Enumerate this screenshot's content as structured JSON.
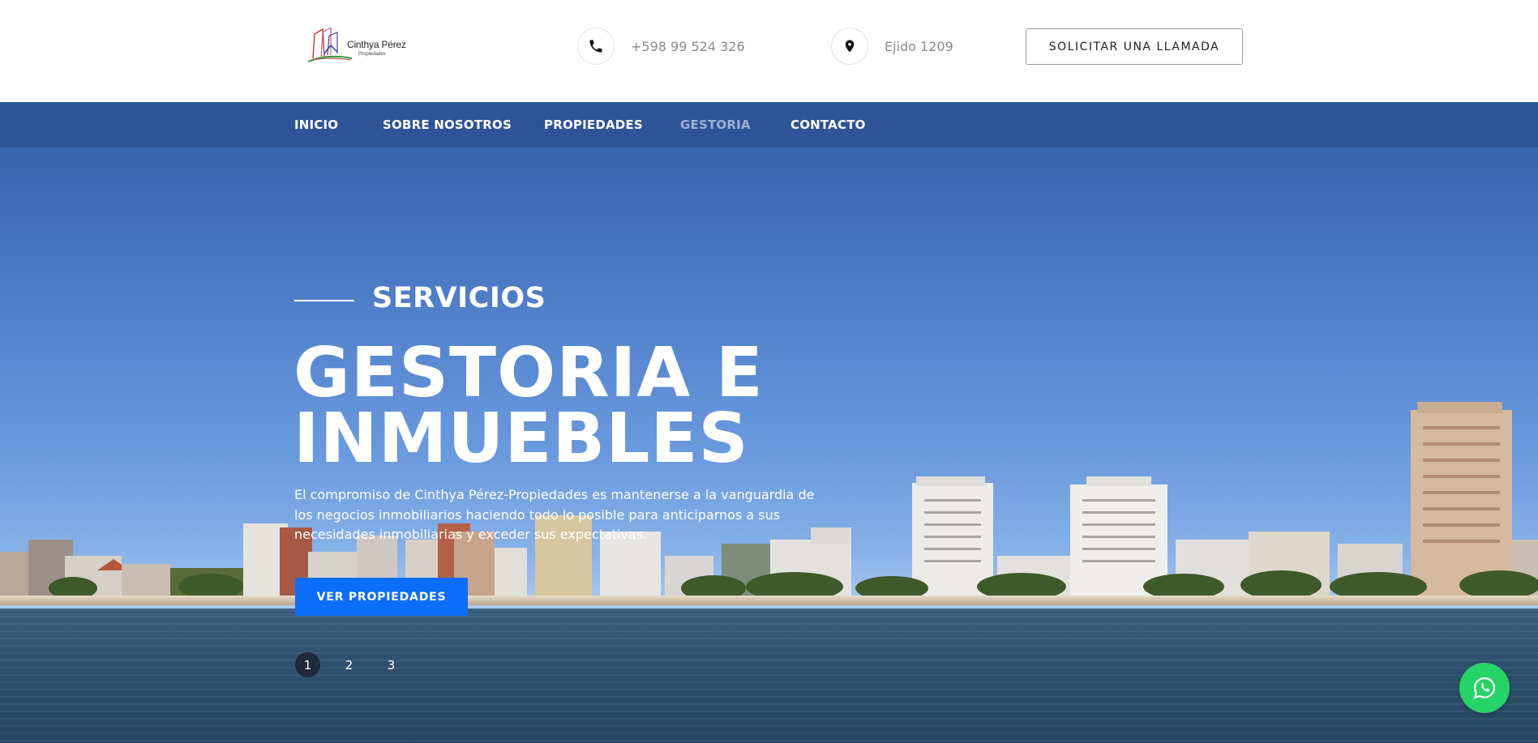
{
  "header": {
    "logo": {
      "name": "Cinthya Pérez",
      "sub": "Propiedades"
    },
    "phone": {
      "icon": "phone-icon",
      "text": "+598 99 524 326"
    },
    "address": {
      "icon": "map-pin-icon",
      "text": "Ejido 1209"
    },
    "call_button": "SOLICITAR UNA LLAMADA"
  },
  "nav": {
    "items": [
      {
        "label": "INICIO",
        "active": false
      },
      {
        "label": "SOBRE NOSOTROS",
        "active": false
      },
      {
        "label": "PROPIEDADES",
        "active": false
      },
      {
        "label": "GESTORIA",
        "active": true
      },
      {
        "label": "CONTACTO",
        "active": false
      }
    ]
  },
  "hero": {
    "eyebrow": "SERVICIOS",
    "title_line1": "GESTORIA E",
    "title_line2": "INMUEBLES",
    "description": "El compromiso de Cinthya Pérez-Propiedades es mantenerse a la vanguardia de los negocios inmobiliarios haciendo todo lo posible para anticiparnos a sus necesidades inmobiliarias y exceder sus expectativas.",
    "cta": "VER PROPIEDADES",
    "slides": [
      "1",
      "2",
      "3"
    ],
    "active_slide": "1"
  },
  "floating": {
    "whatsapp_icon": "whatsapp-icon"
  },
  "colors": {
    "nav_bg": "#2b5091",
    "cta": "#0d6efd",
    "whatsapp": "#25d366",
    "active_nav": "#9fb0d4"
  }
}
